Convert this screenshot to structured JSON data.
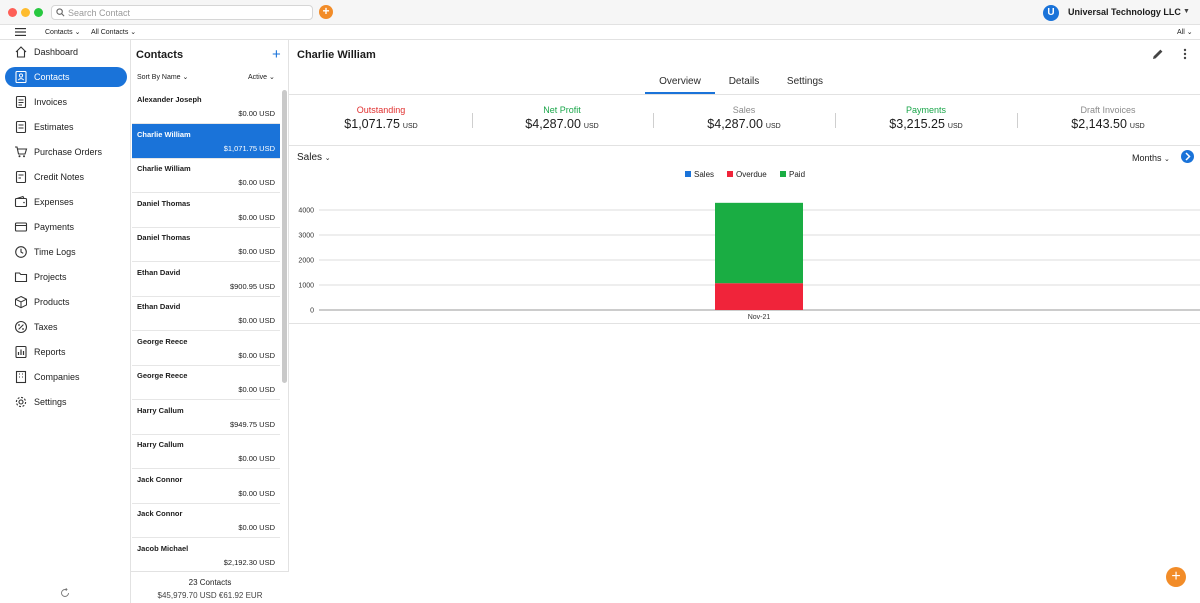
{
  "titlebar": {
    "search_placeholder": "Search Contact",
    "org_initial": "U",
    "org_name": "Universal Technology LLC"
  },
  "subbar": {
    "menu1": "Contacts",
    "menu2": "All Contacts",
    "right": "All"
  },
  "sidebar": {
    "items": [
      {
        "label": "Dashboard",
        "icon": "home-icon"
      },
      {
        "label": "Contacts",
        "icon": "contacts-icon"
      },
      {
        "label": "Invoices",
        "icon": "invoice-icon"
      },
      {
        "label": "Estimates",
        "icon": "estimate-icon"
      },
      {
        "label": "Purchase Orders",
        "icon": "cart-icon"
      },
      {
        "label": "Credit Notes",
        "icon": "credit-note-icon"
      },
      {
        "label": "Expenses",
        "icon": "wallet-icon"
      },
      {
        "label": "Payments",
        "icon": "payment-icon"
      },
      {
        "label": "Time Logs",
        "icon": "clock-icon"
      },
      {
        "label": "Projects",
        "icon": "folder-icon"
      },
      {
        "label": "Products",
        "icon": "box-icon"
      },
      {
        "label": "Taxes",
        "icon": "percent-icon"
      },
      {
        "label": "Reports",
        "icon": "report-icon"
      },
      {
        "label": "Companies",
        "icon": "building-icon"
      },
      {
        "label": "Settings",
        "icon": "gear-icon"
      }
    ],
    "active_index": 1
  },
  "contacts": {
    "title": "Contacts",
    "sort_label": "Sort By Name",
    "filter_label": "Active",
    "rows": [
      {
        "name": "Alexander Joseph",
        "amount": "$0.00 USD"
      },
      {
        "name": "Charlie William",
        "amount": "$1,071.75 USD"
      },
      {
        "name": "Charlie William",
        "amount": "$0.00 USD"
      },
      {
        "name": "Daniel Thomas",
        "amount": "$0.00 USD"
      },
      {
        "name": "Daniel Thomas",
        "amount": "$0.00 USD"
      },
      {
        "name": "Ethan David",
        "amount": "$900.95 USD"
      },
      {
        "name": "Ethan David",
        "amount": "$0.00 USD"
      },
      {
        "name": "George Reece",
        "amount": "$0.00 USD"
      },
      {
        "name": "George Reece",
        "amount": "$0.00 USD"
      },
      {
        "name": "Harry Callum",
        "amount": "$949.75 USD"
      },
      {
        "name": "Harry Callum",
        "amount": "$0.00 USD"
      },
      {
        "name": "Jack Connor",
        "amount": "$0.00 USD"
      },
      {
        "name": "Jack Connor",
        "amount": "$0.00 USD"
      },
      {
        "name": "Jacob Michael",
        "amount": "$2,192.30 USD"
      }
    ],
    "selected_index": 1,
    "footer_count": "23 Contacts",
    "footer_totals": "$45,979.70 USD €61.92 EUR"
  },
  "main": {
    "title": "Charlie William",
    "tabs": [
      {
        "label": "Overview"
      },
      {
        "label": "Details"
      },
      {
        "label": "Settings"
      }
    ],
    "active_tab": 0,
    "stats": [
      {
        "label": "Outstanding",
        "value": "$1,071.75",
        "unit": "USD",
        "color": "#e0302f"
      },
      {
        "label": "Net Profit",
        "value": "$4,287.00",
        "unit": "USD",
        "color": "#1aa64a"
      },
      {
        "label": "Sales",
        "value": "$4,287.00",
        "unit": "USD",
        "color": "#8a8a8a"
      },
      {
        "label": "Payments",
        "value": "$3,215.25",
        "unit": "USD",
        "color": "#1aa64a"
      },
      {
        "label": "Draft Invoices",
        "value": "$2,143.50",
        "unit": "USD",
        "color": "#8a8a8a"
      }
    ],
    "chart_selector": "Sales",
    "period_selector": "Months"
  },
  "chart_data": {
    "type": "bar",
    "stacked": true,
    "categories": [
      "Nov-21"
    ],
    "series": [
      {
        "name": "Sales",
        "color": "#1a73d9",
        "values": [
          0
        ]
      },
      {
        "name": "Overdue",
        "color": "#f0243a",
        "values": [
          1072
        ]
      },
      {
        "name": "Paid",
        "color": "#1aad43",
        "values": [
          3215
        ]
      }
    ],
    "yticks": [
      "0",
      "1000",
      "2000",
      "3000",
      "4000"
    ],
    "ylim": [
      0,
      4000
    ],
    "legend_position": "top-center",
    "grid": true
  }
}
